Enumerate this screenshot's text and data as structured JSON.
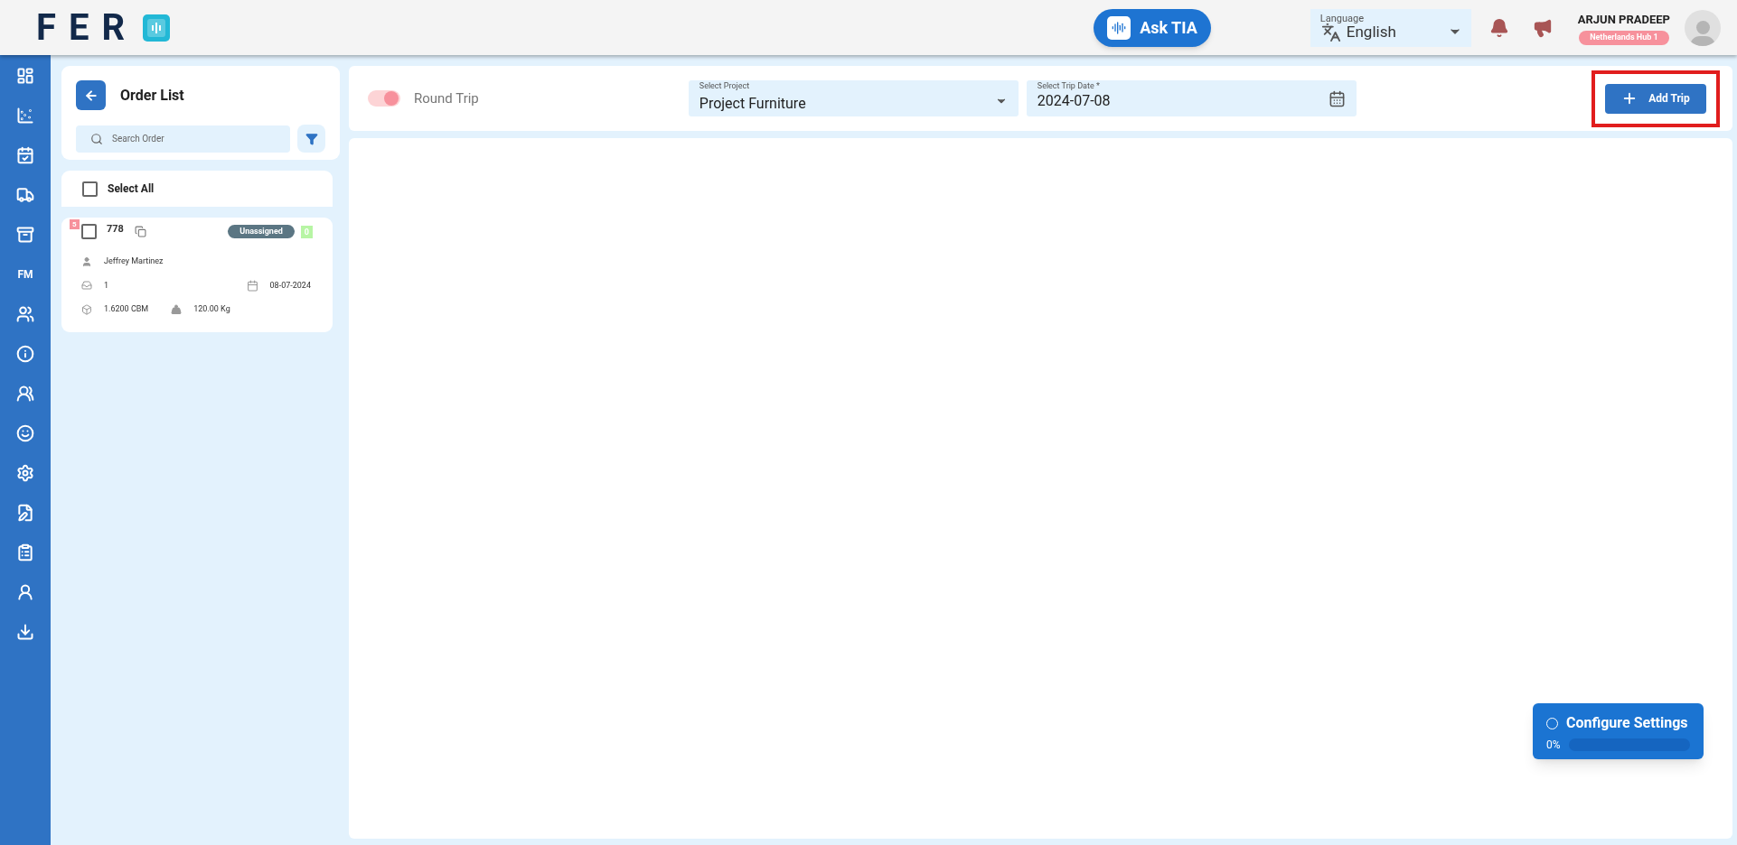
{
  "header": {
    "logo_text": "FER",
    "ask_button": "Ask TIA",
    "language": {
      "label": "Language",
      "value": "English"
    },
    "user": {
      "name": "ARJUN PRADEEP",
      "hub": "Netherlands Hub 1"
    }
  },
  "sidebar": {
    "items": [
      {
        "kind": "icon"
      },
      {
        "kind": "icon"
      },
      {
        "kind": "icon"
      },
      {
        "kind": "icon"
      },
      {
        "kind": "icon"
      },
      {
        "kind": "text",
        "label": "FM"
      },
      {
        "kind": "icon"
      },
      {
        "kind": "icon"
      },
      {
        "kind": "icon"
      },
      {
        "kind": "icon"
      },
      {
        "kind": "icon"
      },
      {
        "kind": "icon"
      },
      {
        "kind": "icon"
      },
      {
        "kind": "icon"
      },
      {
        "kind": "icon"
      }
    ]
  },
  "order_list": {
    "title": "Order List",
    "search": {
      "placeholder": "Search Order"
    },
    "select_all": {
      "label": "Select All",
      "checked": false
    },
    "orders": [
      {
        "priority": "5",
        "number": "778",
        "checked": false,
        "status": "Unassigned",
        "count": "0",
        "customer": "Jeffrey Martinez",
        "packages": "1",
        "date": "08-07-2024",
        "volume": "1.6200 CBM",
        "weight": "120.00 Kg"
      }
    ]
  },
  "toolbar": {
    "round_trip": {
      "label": "Round Trip",
      "on": true
    },
    "project": {
      "label": "Select Project",
      "value": "Project Furniture"
    },
    "trip_date": {
      "label": "Select Trip Date *",
      "value": "2024-07-08"
    },
    "add_trip": {
      "label": "Add Trip",
      "highlighted": true
    }
  },
  "configure_settings": {
    "title": "Configure Settings",
    "reading": "0%",
    "level": 0
  }
}
